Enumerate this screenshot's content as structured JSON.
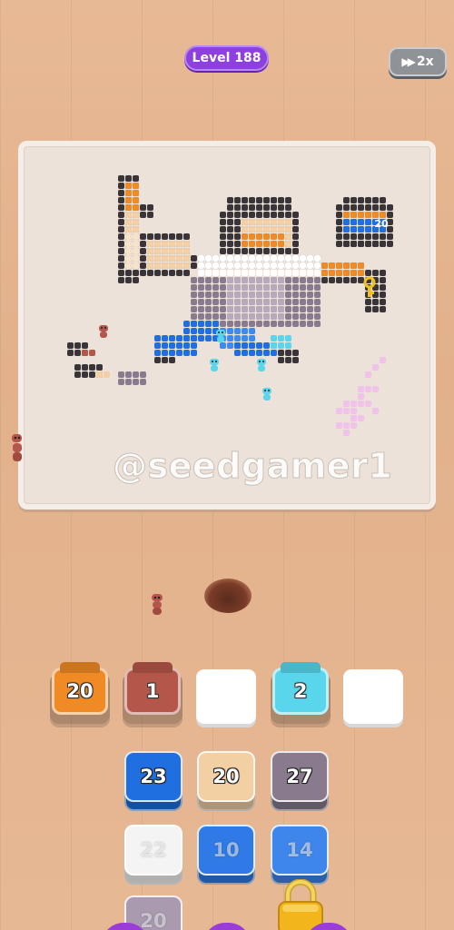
{
  "header": {
    "level_label": "Level 188",
    "speed_label": "2x",
    "speed_icon": "fast-forward-icon"
  },
  "board": {
    "coin_value": "20",
    "watermark": "@seedgamer1"
  },
  "slots": [
    {
      "value": "20",
      "color": "#f08a24"
    },
    {
      "value": "1",
      "color": "#b5564a"
    },
    {
      "value": "",
      "color": "#ffffff"
    },
    {
      "value": "2",
      "color": "#5ad6ec"
    },
    {
      "value": "",
      "color": "#ffffff"
    }
  ],
  "tiles": [
    {
      "value": "23",
      "color": "#1f6fe0",
      "locked": false
    },
    {
      "value": "20",
      "color": "#f3cfa4",
      "locked": false
    },
    {
      "value": "27",
      "color": "#8a7a8e",
      "locked": false
    },
    {
      "value": "22",
      "color": "#f4f4f4",
      "locked": true
    },
    {
      "value": "10",
      "color": "#2f7ae6",
      "locked": true
    },
    {
      "value": "14",
      "color": "#3f86ec",
      "locked": true
    },
    {
      "value": "20",
      "color": "#a99ab0",
      "locked": true
    }
  ],
  "colors": {
    "accent": "#8e3fe0",
    "orange": "#f08a24",
    "brown": "#b5564a",
    "cyan": "#5ad6ec",
    "blue": "#1f6fe0",
    "skin": "#f3cfa4",
    "purple_grey": "#8a7a8e",
    "dark": "#3a3438",
    "pink": "#f1c2ea"
  }
}
